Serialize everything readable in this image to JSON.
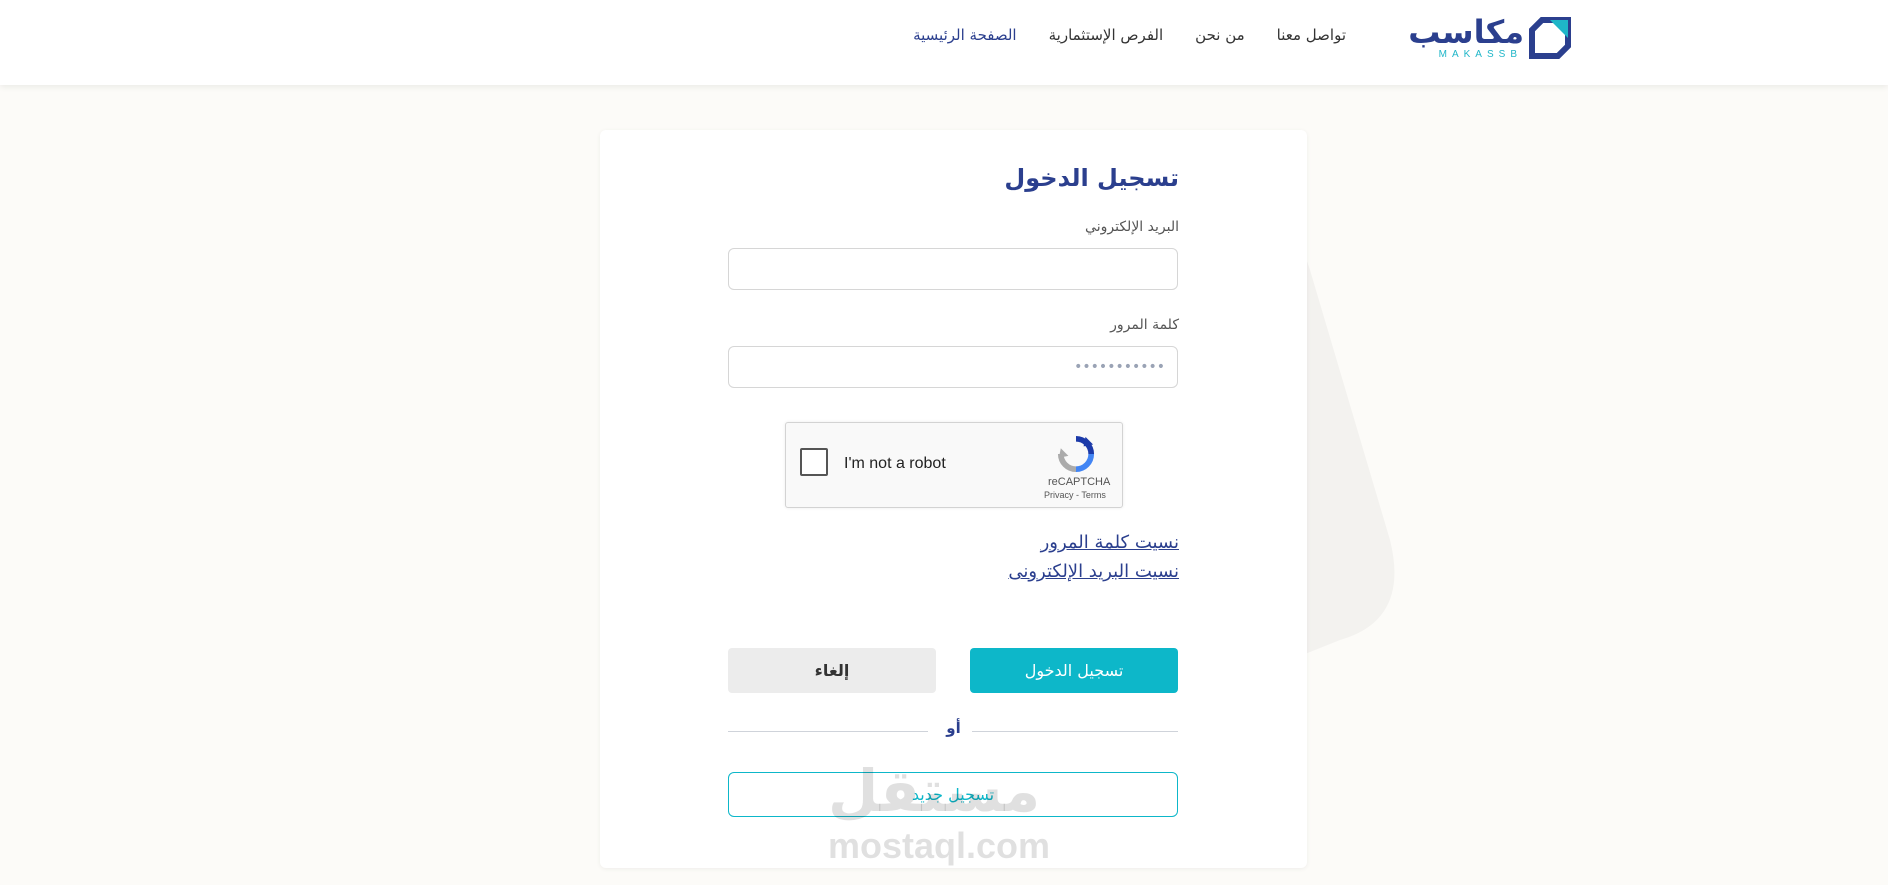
{
  "header": {
    "logo": {
      "name": "مكاسب",
      "latin": "MAKASSB"
    },
    "nav": [
      {
        "label": "الصفحة الرئيسية",
        "active": true
      },
      {
        "label": "الفرص الإستثمارية",
        "active": false
      },
      {
        "label": "من نحن",
        "active": false
      },
      {
        "label": "تواصل معنا",
        "active": false
      }
    ]
  },
  "login": {
    "title": "تسجيل الدخول",
    "email_label": "البريد الإلكتروني",
    "email_value": "",
    "password_label": "كلمة المرور",
    "password_placeholder": "•••••••••••",
    "captcha": {
      "text": "I'm not a robot",
      "brand": "reCAPTCHA",
      "privacy": "Privacy",
      "separator": " - ",
      "terms": "Terms",
      "checked": false
    },
    "forgot_password": "نسيت كلمة المرور",
    "forgot_email": "نسيت البريد الإلكترونى",
    "login_button": "تسجيل الدخول",
    "cancel_button": "إلغاء",
    "or_text": "أو",
    "register_button": "تسجيل جديد"
  },
  "watermark": {
    "arabic": "مستقل",
    "latin": "mostaql.com"
  },
  "colors": {
    "primary": "#2b3f8e",
    "accent": "#0db7c9",
    "background": "#fcfbf8"
  }
}
